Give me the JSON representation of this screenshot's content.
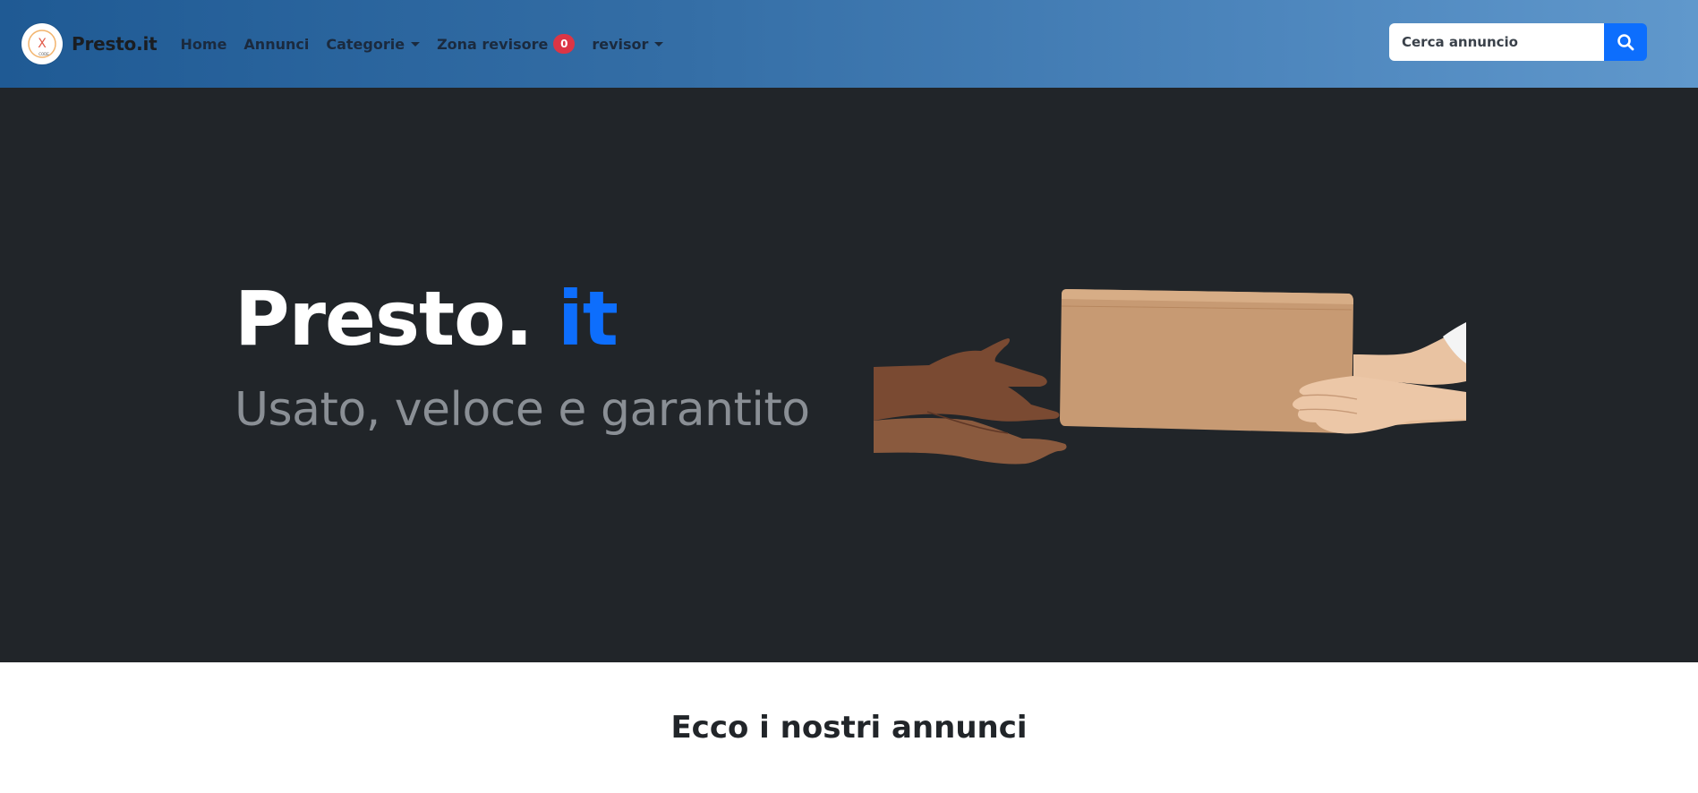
{
  "brand": {
    "name": "Presto.it",
    "logo_text": "X",
    "logo_small_text": "CODE"
  },
  "nav": {
    "home": "Home",
    "annunci": "Annunci",
    "categorie": "Categorie",
    "zona_revisore": "Zona revisore",
    "revisor_badge_count": "0",
    "user": "revisor"
  },
  "search": {
    "placeholder": "Cerca annuncio",
    "value": ""
  },
  "hero": {
    "title_main": "Presto.",
    "title_accent": "it",
    "subtitle": "Usato, veloce e garantito"
  },
  "section": {
    "title": "Ecco i nostri annunci"
  },
  "icons": {
    "logo": "presto-logo-icon",
    "search": "search-icon",
    "dropdown": "caret-down-icon",
    "hero_image": "hands-passing-box-illustration"
  },
  "colors": {
    "nav_gradient_start": "#1f5a94",
    "nav_gradient_end": "#6098cc",
    "hero_bg": "#212529",
    "accent": "#0d6efd",
    "badge": "#dc3545"
  }
}
